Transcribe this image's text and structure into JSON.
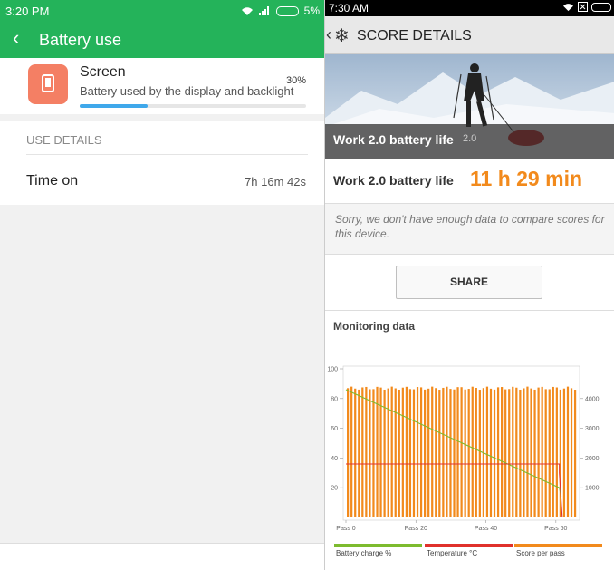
{
  "left": {
    "status": {
      "time": "3:20 PM",
      "battery": "5%"
    },
    "title": "Battery use",
    "item": {
      "name": "Screen",
      "description": "Battery used by the display and backlight",
      "percent_label": "30%",
      "percent_value": 0.3
    },
    "details_header": "USE DETAILS",
    "rows": [
      {
        "label": "Time on",
        "value": "7h 16m 42s"
      }
    ],
    "colors": {
      "header": "#24b35a",
      "icon_bg": "#f47f64",
      "bar": "#3fa8eb"
    }
  },
  "right": {
    "status": {
      "time": "7:30 AM"
    },
    "title": "SCORE DETAILS",
    "hero_caption": "Work 2.0 battery life",
    "hero_badge": "2.0",
    "score_label": "Work 2.0 battery life",
    "score_value": "11 h 29 min",
    "note": "Sorry, we don't have enough data to compare scores for this device.",
    "share_label": "SHARE",
    "monitoring_label": "Monitoring data",
    "colors": {
      "score": "#f28a1c",
      "battery": "#7dbb2f",
      "temperature": "#e0312b",
      "score_pass": "#f28a1c"
    }
  },
  "chart_data": {
    "type": "line",
    "x_tick_labels": [
      "Pass 0",
      "Pass 20",
      "Pass 40",
      "Pass 60"
    ],
    "x_ticks": [
      0,
      20,
      40,
      60
    ],
    "xlim": [
      0,
      66
    ],
    "left_axis": {
      "ylim": [
        0,
        100
      ],
      "ticks": [
        20,
        40,
        60,
        80,
        100
      ]
    },
    "right_axis": {
      "ylim": [
        0,
        5000
      ],
      "ticks": [
        1000,
        2000,
        3000,
        4000
      ]
    },
    "series": [
      {
        "name": "Battery charge %",
        "axis": "left",
        "color": "#7dbb2f",
        "x": [
          0,
          61,
          61.5
        ],
        "y": [
          86,
          20,
          14
        ]
      },
      {
        "name": "Temperature °C",
        "axis": "left",
        "color": "#e0312b",
        "x": [
          0,
          61,
          61,
          61.8
        ],
        "y": [
          36,
          36,
          30,
          0
        ]
      },
      {
        "name": "Score per pass",
        "axis": "right",
        "color": "#f28a1c",
        "render": "bars",
        "count": 63,
        "value": 4350
      }
    ]
  }
}
